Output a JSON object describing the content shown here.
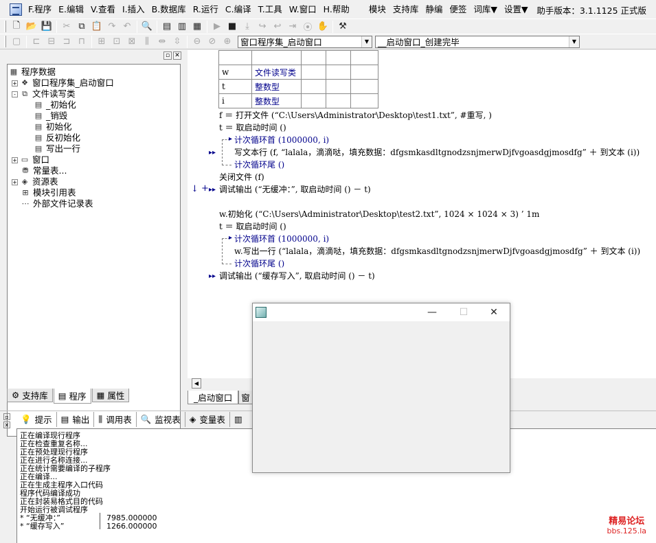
{
  "menubar": {
    "items": [
      "F.程序",
      "E.编辑",
      "V.查看",
      "I.插入",
      "B.数据库",
      "R.运行",
      "C.编译",
      "T.工具",
      "W.窗口",
      "H.帮助"
    ],
    "extra_items": [
      "模块",
      "支持库",
      "静编",
      "便签",
      "词库▼",
      "设置▼"
    ],
    "version": "助手版本：3.1.1125 正式版"
  },
  "toolbar2": {
    "combo_left": "窗口程序集_启动窗口",
    "combo_right": "__启动窗口_创建完毕"
  },
  "tree": {
    "root": "程序数据",
    "items": [
      {
        "label": "窗口程序集_启动窗口",
        "level": 1,
        "twisty": "+"
      },
      {
        "label": "文件读写类",
        "level": 1,
        "twisty": "-"
      },
      {
        "label": "_初始化",
        "level": 2
      },
      {
        "label": "_销毁",
        "level": 2
      },
      {
        "label": "初始化",
        "level": 2
      },
      {
        "label": "反初始化",
        "level": 2
      },
      {
        "label": "写出一行",
        "level": 2
      },
      {
        "label": "窗口",
        "level": 1,
        "twisty": "+"
      },
      {
        "label": "常量表...",
        "level": 1
      },
      {
        "label": "资源表",
        "level": 1,
        "twisty": "+"
      },
      {
        "label": "模块引用表",
        "level": 1
      },
      {
        "label": "外部文件记录表",
        "level": 1
      }
    ]
  },
  "left_tabs": [
    "支持库",
    "程序",
    "属性"
  ],
  "var_table": [
    [
      "",
      "",
      "",
      "",
      ""
    ],
    [
      "w",
      "文件读写类",
      "",
      "",
      ""
    ],
    [
      "t",
      "整数型",
      "",
      "",
      ""
    ],
    [
      "i",
      "整数型",
      "",
      "",
      ""
    ]
  ],
  "code": {
    "l1": "f ＝ 打开文件 (“C:\\Users\\Administrator\\Desktop\\test1.txt”, #重写, )",
    "l2": "t ＝ 取启动时间 ()",
    "l3": "计次循环首 (1000000, i)",
    "l4": "写文本行 (f, “lalala，滴滴哒，填充数据：dfgsmkasdltgnodzsnjmerwDjfvgoasdgjmosdfg” ＋ 到文本 (i))",
    "l5": "计次循环尾 ()",
    "l6": "关闭文件 (f)",
    "l7": "调试输出 (“无缓冲：”, 取启动时间 () － t)",
    "l8": "w.初始化 (“C:\\Users\\Administrator\\Desktop\\test2.txt”, 1024 × 1024 × 3)  ’ 1m",
    "l9": "t ＝ 取启动时间 ()",
    "l10": "计次循环首 (1000000, i)",
    "l11": "w.写出一行 (“lalala，滴滴哒，填充数据：dfgsmkasdltgnodzsnjmerwDjfvgoasdgjmosdfg” ＋ 到文本 (i))",
    "l12": "计次循环尾 ()",
    "l13": "调试输出 (“缓存写入”, 取启动时间 () － t)"
  },
  "editor_tabs": [
    "_启动窗口",
    "窗"
  ],
  "output_tabs": [
    "提示",
    "输出",
    "调用表",
    "监视表",
    "变量表"
  ],
  "output_lines": [
    "正在编译现行程序",
    "正在检查重复名称...",
    "正在预处理现行程序",
    "正在进行名称连接...",
    "正在统计需要编译的子程序",
    "正在编译...",
    "正在生成主程序入口代码",
    "程序代码编译成功",
    "正在封装易格式目的代码",
    "开始运行被调试程序",
    "* “无缓冲：”",
    "* “缓存写入”"
  ],
  "output_values": [
    "7985.000000",
    "1266.000000"
  ],
  "watermark": {
    "line1": "精易论坛",
    "line2": "bbs.125.la"
  },
  "colors": {
    "keyword": "#00008b",
    "string": "#006a6a",
    "watermark": "#dd2222"
  }
}
